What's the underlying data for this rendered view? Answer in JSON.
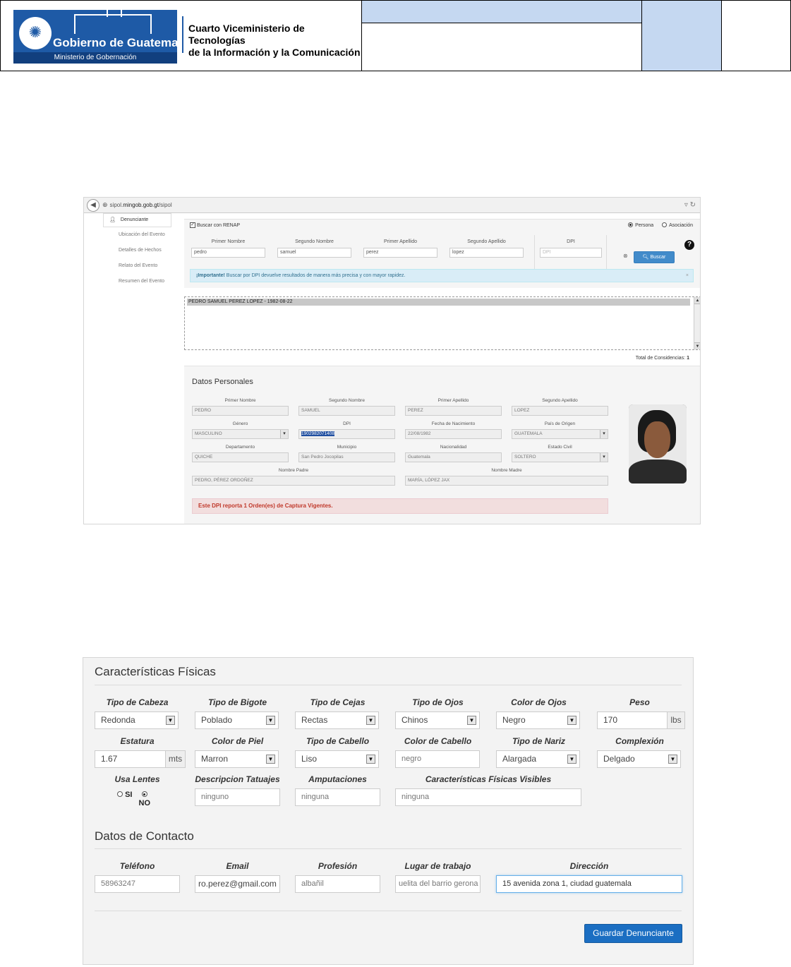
{
  "header": {
    "logo_title": "Gobierno de Guatemala",
    "logo_subtitle": "Ministerio de Gobernación",
    "org_line1": "Cuarto Viceministerio de Tecnologías",
    "org_line2": "de la Información y la Comunicación"
  },
  "browser": {
    "url_prefix": "sipol.",
    "url_domain": "mingob.gob.gt",
    "url_path": "/sipol"
  },
  "sidebar": {
    "items": [
      {
        "label": "Denunciante"
      },
      {
        "label": "Ubicación del Evento"
      },
      {
        "label": "Detalles de Hechos"
      },
      {
        "label": "Relato del Evento"
      },
      {
        "label": "Resumen del Evento"
      }
    ]
  },
  "search": {
    "renap_label": "Buscar con RENAP",
    "radio_persona": "Persona",
    "radio_asociacion": "Asociación",
    "fields": [
      {
        "label": "Primer Nombre",
        "value": "pedro"
      },
      {
        "label": "Segundo Nombre",
        "value": "samuel"
      },
      {
        "label": "Primer Apellido",
        "value": "perez"
      },
      {
        "label": "Segundo Apellido",
        "value": "lopez"
      },
      {
        "label": "DPI",
        "placeholder": "DPI"
      }
    ],
    "button": "Buscar",
    "alert_strong": "¡Importante!",
    "alert_text": " Buscar por DPI devuelve resultados de manera más precisa y con mayor rapidez."
  },
  "results": {
    "items": [
      "PEDRO SAMUEL PEREZ LOPEZ - 1982-08-22"
    ],
    "total_label": "Total de Considencias:",
    "total_value": "1"
  },
  "datos": {
    "title": "Datos Personales",
    "fields": [
      {
        "label": "Primer Nombre",
        "value": "PEDRO"
      },
      {
        "label": "Segundo Nombre",
        "value": "SAMUEL"
      },
      {
        "label": "Primer Apellido",
        "value": "PEREZ"
      },
      {
        "label": "Segundo Apellido",
        "value": "LOPEZ"
      },
      {
        "label": "Género",
        "value": "MASCULINO"
      },
      {
        "label": "DPI",
        "value": "1902982071408"
      },
      {
        "label": "Fecha de Nacimiento",
        "value": "22/08/1982"
      },
      {
        "label": "País de Origen",
        "value": "GUATEMALA"
      },
      {
        "label": "Departamento",
        "value": "QUICHE"
      },
      {
        "label": "Municipio",
        "value": "San Pedro Jocopilas"
      },
      {
        "label": "Nacionalidad",
        "value": "Guatemala"
      },
      {
        "label": "Estado Civil",
        "value": "SOLTERO"
      },
      {
        "label": "Nombre Padre",
        "value": "PEDRO, PÉREZ ORDOÑEZ"
      },
      {
        "label": "Nombre Madre",
        "value": "MARÍA, LÓPEZ JAX"
      }
    ],
    "alert": "Este DPI reporta 1 Orden(es) de Captura Vigentes."
  },
  "fisicas": {
    "title": "Características Físicas",
    "row1": [
      {
        "label": "Tipo de Cabeza",
        "value": "Redonda"
      },
      {
        "label": "Tipo de Bigote",
        "value": "Poblado"
      },
      {
        "label": "Tipo de Cejas",
        "value": "Rectas"
      },
      {
        "label": "Tipo de Ojos",
        "value": "Chinos"
      },
      {
        "label": "Color de Ojos",
        "value": "Negro"
      },
      {
        "label": "Peso",
        "value": "170",
        "unit": "lbs"
      }
    ],
    "row2": [
      {
        "label": "Estatura",
        "value": "1.67",
        "unit": "mts"
      },
      {
        "label": "Color de Piel",
        "value": "Marron"
      },
      {
        "label": "Tipo de Cabello",
        "value": "Liso"
      },
      {
        "label": "Color de Cabello",
        "value": "negro"
      },
      {
        "label": "Tipo de Nariz",
        "value": "Alargada"
      },
      {
        "label": "Complexión",
        "value": "Delgado"
      }
    ],
    "row3": [
      {
        "label": "Usa Lentes",
        "opt_si": "SI",
        "opt_no": "NO"
      },
      {
        "label": "Descripcion Tatuajes",
        "value": "ninguno"
      },
      {
        "label": "Amputaciones",
        "value": "ninguna"
      },
      {
        "label": "Características Físicas Visibles",
        "value": "ninguna"
      }
    ]
  },
  "contacto": {
    "title": "Datos de Contacto",
    "fields": [
      {
        "label": "Teléfono",
        "value": "58963247"
      },
      {
        "label": "Email",
        "value": "ro.perez@gmail.com"
      },
      {
        "label": "Profesión",
        "value": "albañil"
      },
      {
        "label": "Lugar de trabajo",
        "value": "uelita del barrio gerona"
      },
      {
        "label": "Dirección",
        "value": "15 avenida zona 1, ciudad guatemala"
      }
    ],
    "save_button": "Guardar Denunciante"
  }
}
